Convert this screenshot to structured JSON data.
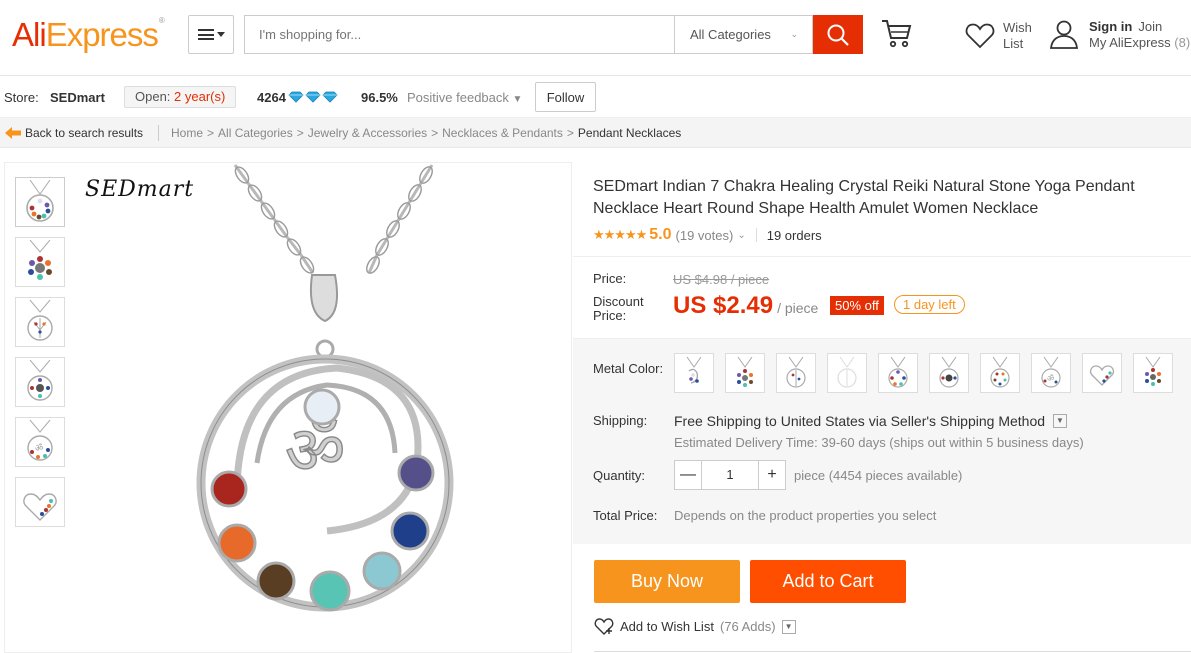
{
  "header": {
    "logo_ali": "Ali",
    "logo_express": "Express",
    "logo_mark": "®",
    "search_placeholder": "I'm shopping for...",
    "category_select": "All Categories",
    "wish_line1": "Wish",
    "wish_line2": "List",
    "sign_in": "Sign in",
    "join": "Join",
    "my_aliexpress": "My AliExpress",
    "my_count": "(8)"
  },
  "store": {
    "label": "Store:",
    "name": "SEDmart",
    "open_prefix": "Open:",
    "open_years": "2 year(s)",
    "score": "4264",
    "positive_pct": "96.5%",
    "positive_label": "Positive feedback",
    "follow": "Follow"
  },
  "breadcrumb": {
    "back": "Back to search results",
    "items": [
      "Home",
      "All Categories",
      "Jewelry & Accessories",
      "Necklaces & Pendants"
    ],
    "current": "Pendant Necklaces"
  },
  "gallery": {
    "brand_mark": "SEDmart",
    "thumb_count": 6
  },
  "product": {
    "title": "SEDmart Indian 7 Chakra Healing Crystal Reiki Natural Stone Yoga Pendant Necklace Heart Round Shape Health Amulet Women Necklace",
    "stars": "★★★★★",
    "rating": "5.0",
    "votes": "(19 votes)",
    "orders": "19 orders",
    "price_label": "Price:",
    "old_price": "US $4.98 / piece",
    "discount_label_1": "Discount",
    "discount_label_2": "Price:",
    "new_price": "US $2.49",
    "per_piece": "/ piece",
    "off": "50% off",
    "days_left": "1 day left",
    "metal_color_label": "Metal Color:",
    "shipping_label": "Shipping:",
    "shipping_free": "Free Shipping to",
    "shipping_country": "United States",
    "shipping_via": "via Seller's Shipping Method",
    "eta": "Estimated Delivery Time: 39-60 days (ships out within 5 business days)",
    "quantity_label": "Quantity:",
    "quantity_value": "1",
    "quantity_minus": "—",
    "quantity_plus": "+",
    "quantity_note": "piece (4454 pieces available)",
    "total_label": "Total Price:",
    "total_value": "Depends on the product properties you select",
    "buy_now": "Buy Now",
    "add_to_cart": "Add to Cart",
    "wishlist": "Add to Wish List",
    "wishlist_adds": "(76 Adds)"
  },
  "colors": {
    "brand_red": "#e62e04",
    "brand_orange": "#f7941d",
    "cart_orange": "#ff4e00"
  }
}
